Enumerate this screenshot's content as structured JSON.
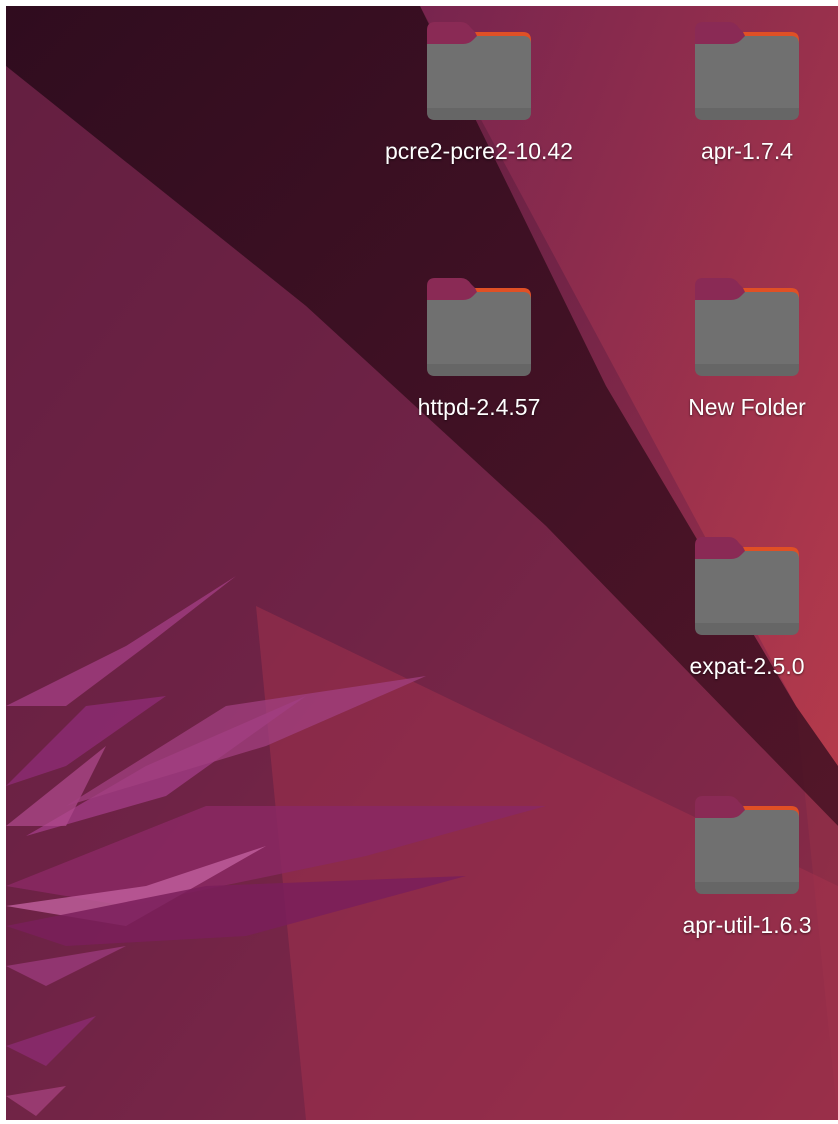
{
  "desktop": {
    "icons": [
      {
        "label": "pcre2-pcre2-10.42",
        "type": "folder",
        "icon": "folder-icon"
      },
      {
        "label": "apr-1.7.4",
        "type": "folder",
        "icon": "folder-icon"
      },
      {
        "label": "httpd-2.4.57",
        "type": "folder",
        "icon": "folder-icon"
      },
      {
        "label": "New Folder",
        "type": "folder",
        "icon": "folder-icon"
      },
      {
        "label": "expat-2.5.0",
        "type": "folder",
        "icon": "folder-icon"
      },
      {
        "label": "apr-util-1.6.3",
        "type": "folder",
        "icon": "folder-icon"
      }
    ]
  },
  "colors": {
    "folder_body": "#6f6f6f",
    "folder_tab_dark": "#8a2a55",
    "folder_tab_accent": "#e95420",
    "label_text": "#ffffff"
  }
}
